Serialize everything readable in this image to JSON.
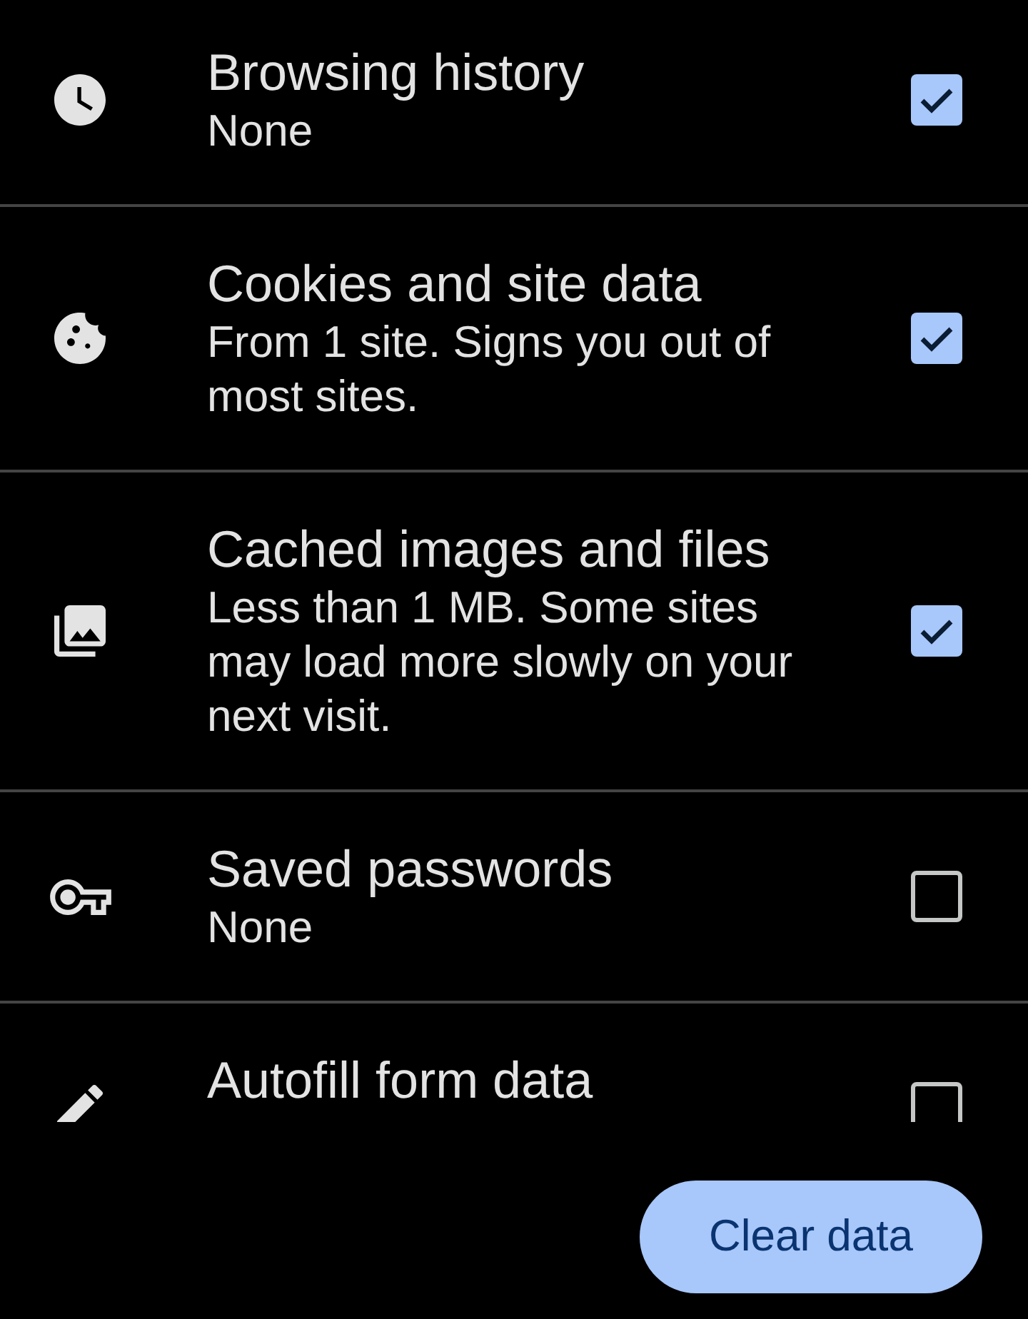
{
  "items": [
    {
      "kind": "history",
      "title": "Browsing history",
      "subtitle": "None",
      "checked": true
    },
    {
      "kind": "cookies",
      "title": "Cookies and site data",
      "subtitle": "From 1 site. Signs you out of most sites.",
      "checked": true
    },
    {
      "kind": "cache",
      "title": "Cached images and files",
      "subtitle": "Less than 1 MB. Some sites may load more slowly on your next visit.",
      "checked": true
    },
    {
      "kind": "passwords",
      "title": "Saved passwords",
      "subtitle": "None",
      "checked": false
    },
    {
      "kind": "autofill",
      "title": "Autofill form data",
      "checked": false
    }
  ],
  "clear_button": {
    "label": "Clear data"
  }
}
